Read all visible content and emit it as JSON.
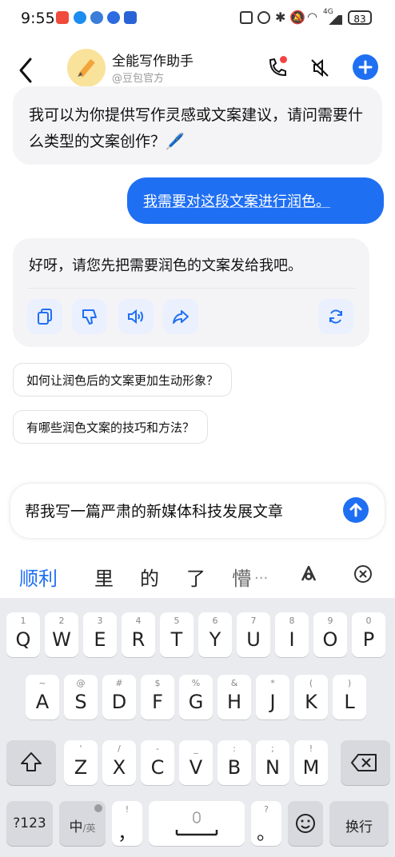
{
  "status_bar": {
    "time": "9:55",
    "battery": "83",
    "network": "4G"
  },
  "header": {
    "title": "全能写作助手",
    "subtitle": "@豆包官方"
  },
  "messages": {
    "bot1": "我可以为你提供写作灵感或文案建议，请问需要什么类型的文案创作？🖊️",
    "user1": "我需要对这段文案进行润色。",
    "bot2": "好呀，请您先把需要润色的文案发给我吧。"
  },
  "suggestions": [
    "如何让润色后的文案更加生动形象？",
    "有哪些润色文案的技巧和方法？"
  ],
  "input": {
    "text": "帮我写一篇严肃的新媒体科技发展文章"
  },
  "candidates": [
    "顺利",
    "里",
    "的",
    "了",
    "懵",
    "..."
  ],
  "keyboard": {
    "row1": [
      [
        "Q",
        "1"
      ],
      [
        "W",
        "2"
      ],
      [
        "E",
        "3"
      ],
      [
        "R",
        "4"
      ],
      [
        "T",
        "5"
      ],
      [
        "Y",
        "6"
      ],
      [
        "U",
        "7"
      ],
      [
        "I",
        "8"
      ],
      [
        "O",
        "9"
      ],
      [
        "P",
        "0"
      ]
    ],
    "row2": [
      [
        "A",
        "~"
      ],
      [
        "S",
        "@"
      ],
      [
        "D",
        "#"
      ],
      [
        "F",
        "$"
      ],
      [
        "G",
        "%"
      ],
      [
        "H",
        "&"
      ],
      [
        "J",
        "*"
      ],
      [
        "K",
        "("
      ],
      [
        "L",
        ")"
      ]
    ],
    "row3": [
      [
        "Z",
        "'"
      ],
      [
        "X",
        "/"
      ],
      [
        "C",
        "-"
      ],
      [
        "V",
        "_"
      ],
      [
        "B",
        ":"
      ],
      [
        "N",
        ";"
      ],
      [
        "M",
        "!"
      ]
    ],
    "num_key": "?123",
    "lang_key": "中",
    "lang_key_sub": "/英",
    "comma_key": "，",
    "comma_key_sub": "!",
    "period_key": "。",
    "period_key_sub": "?",
    "enter_key": "换行"
  },
  "colors": {
    "accent": "#1f6ff3",
    "bubble": "#f4f4f6",
    "keyboard_bg": "#e9ebef"
  }
}
